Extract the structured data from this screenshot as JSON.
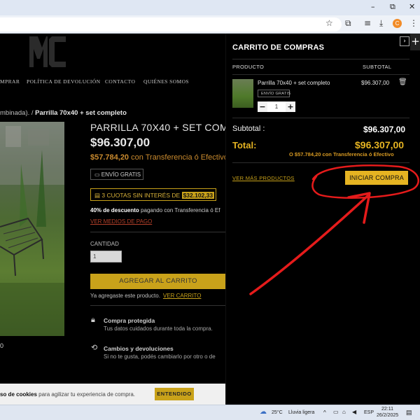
{
  "browser": {
    "window_controls": {
      "minimize": "–",
      "restore": "⧉",
      "close": "✕"
    },
    "profile_initial": "C"
  },
  "nav": {
    "items": [
      "MPRAR",
      "POLÍTICA DE DEVOLUCIÓN",
      "CONTACTO",
      "QUIÉNES SOMOS"
    ]
  },
  "breadcrumb": {
    "prefix": "mbinada).  /",
    "current": "Parrilla 70x40 + set completo"
  },
  "product": {
    "title": "PARRILLA 70X40 + SET COMP",
    "price": "$96.307,00",
    "transfer_price": "$57.784,20",
    "transfer_text": "con Transferencia ó Efectivo",
    "shipping_badge": "ENVÍO GRATIS",
    "cuotas_text": "3 CUOTAS SIN INTERÉS DE",
    "cuotas_value": "$32.102,33",
    "discount_bold": "40% de descuento",
    "discount_rest": "pagando con Transferencia ó Ef",
    "payment_link": "VER MEDIOS DE PAGO",
    "qty_label": "CANTIDAD",
    "qty_value": "1",
    "add_to_cart": "AGREGAR AL CARRITO",
    "added_text": "Ya agregaste este producto.",
    "view_cart": "VER CARRITO",
    "left_edge_zero": "0",
    "features": [
      {
        "title": "Compra protegida",
        "sub": "Tus datos cuidados durante toda la compra."
      },
      {
        "title": "Cambios y devoluciones",
        "sub": "Si no te gusta, podés cambiarlo por otro o de"
      }
    ]
  },
  "cookie": {
    "bold": "so de cookies",
    "rest": "para agilizar tu experiencia de compra.",
    "button": "ENTENDIDO"
  },
  "cart": {
    "title": "CARRITO DE COMPRAS",
    "col_product": "PRODUCTO",
    "col_subtotal": "SUBTOTAL",
    "item": {
      "name": "Parrilla 70x40 + set completo",
      "badge": "ENVÍO GRATIS",
      "qty": "1",
      "price": "$96.307,00"
    },
    "subtotal_label": "Subtotal :",
    "subtotal_value": "$96.307,00",
    "total_label": "Total:",
    "total_value": "$96.307,00",
    "total_alt": "O $57.784,20 con Transferencia ó Efectivo",
    "see_more": "VER MÁS PRODUCTOS",
    "checkout": "INICIAR COMPRA"
  },
  "taskbar": {
    "weather_temp": "25°C",
    "weather_text": "Lluvia ligera",
    "lang": "ESP",
    "time": "22:11",
    "date": "26/2/2025"
  },
  "annotation_color": "#e51b1b",
  "accent_color": "#e6b422"
}
